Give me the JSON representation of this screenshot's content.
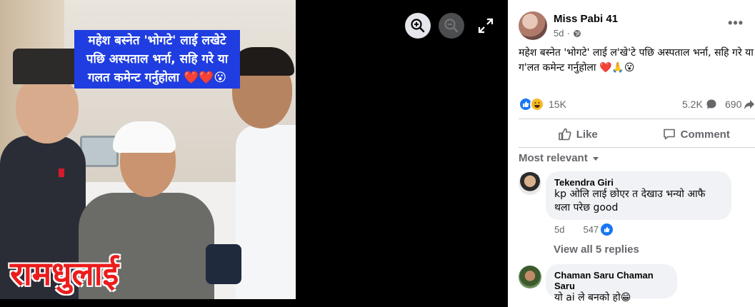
{
  "image_overlay": {
    "caption": "महेश बस्नेत 'भोगटे' लाई लखेटे पछि अस्पताल भर्ना, सहि गरे या गलत कमेन्ट गर्नुहोला ❤️❤️😮",
    "big_word": "रामधुलाई"
  },
  "viewer_controls": {
    "zoom_in_icon": "zoom-in-icon",
    "zoom_out_icon": "zoom-out-icon",
    "expand_icon": "fullscreen-icon"
  },
  "post": {
    "author": "Miss Pabi 41",
    "time": "5d",
    "audience_icon": "globe-icon",
    "more_label": "•••",
    "text": "महेश बस्नेत 'भोगटे' लाई ल'खे'टे पछि अस्पताल भर्ना, सहि गरे या ग'लत कमेन्ट गर्नुहोला ❤️🙏😮",
    "reaction_count": "15K",
    "comment_count": "5.2K",
    "share_count": "690"
  },
  "actions": {
    "like_label": "Like",
    "comment_label": "Comment"
  },
  "sort_label": "Most relevant",
  "comments": [
    {
      "name": "Tekendra Giri",
      "text": "kp ओलि लाई छोएर त देखाउ भन्यो आफै थला परेछ good",
      "time": "5d",
      "likes": "547"
    },
    {
      "name": "Chaman Saru Chaman Saru",
      "text": "यो ai ले बनको हो😁"
    }
  ],
  "view_replies_label": "View all 5 replies",
  "colors": {
    "accent": "#1877f2",
    "muted_text": "#65676b",
    "bubble_bg": "#f0f2f5",
    "caption_bg": "#1f3de0",
    "big_word": "#ec1c1c"
  }
}
